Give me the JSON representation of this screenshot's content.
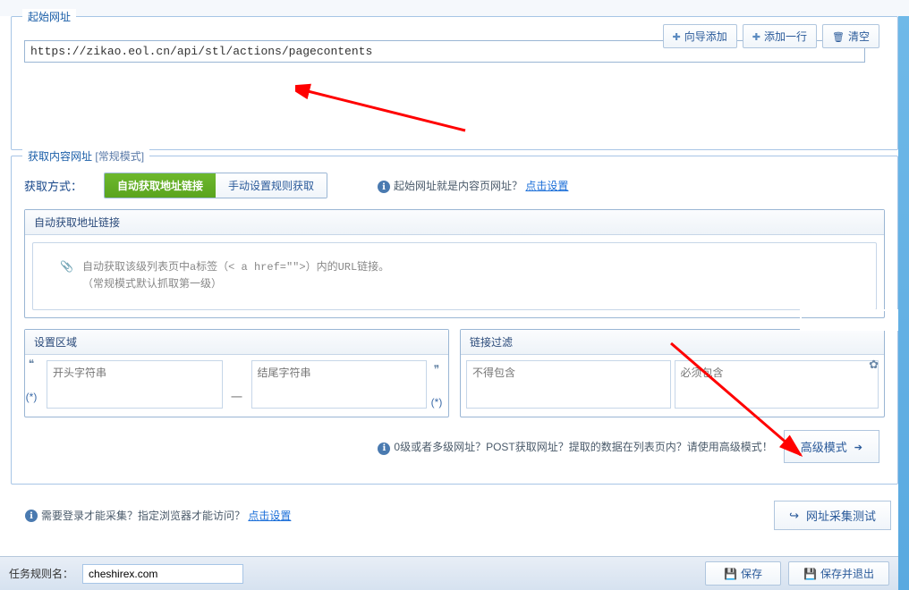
{
  "startUrl": {
    "title": "起始网址",
    "value": "https://zikao.eol.cn/api/stl/actions/pagecontents",
    "buttons": {
      "wizard": "向导添加",
      "addRow": "添加一行",
      "clear": "清空"
    }
  },
  "contentUrl": {
    "title": "获取内容网址",
    "mode": "[常规模式]",
    "fetchLabel": "获取方式：",
    "tab1": "自动获取地址链接",
    "tab2": "手动设置规则获取",
    "hintQ": "起始网址就是内容页网址？",
    "hintLink": "点击设置",
    "autoBox": {
      "head": "自动获取地址链接",
      "line1": "自动获取该级列表页中a标签（< a href=\"\">）内的URL链接。",
      "line2": "（常规模式默认抓取第一级）"
    },
    "areaPanel": {
      "title": "设置区域",
      "startPh": "开头字符串",
      "endPh": "结尾字符串"
    },
    "filterPanel": {
      "title": "链接过滤",
      "excludePh": "不得包含",
      "includePh": "必须包含"
    },
    "advHint": "0级或者多级网址？POST获取网址？提取的数据在列表页内？请使用高级模式！",
    "advBtn": "高级模式"
  },
  "loginRow": {
    "text": "需要登录才能采集？指定浏览器才能访问？",
    "link": "点击设置",
    "testBtn": "网址采集测试"
  },
  "footer": {
    "ruleLabel": "任务规则名：",
    "ruleValue": "cheshirex.com",
    "save": "保存",
    "saveExit": "保存并退出"
  }
}
